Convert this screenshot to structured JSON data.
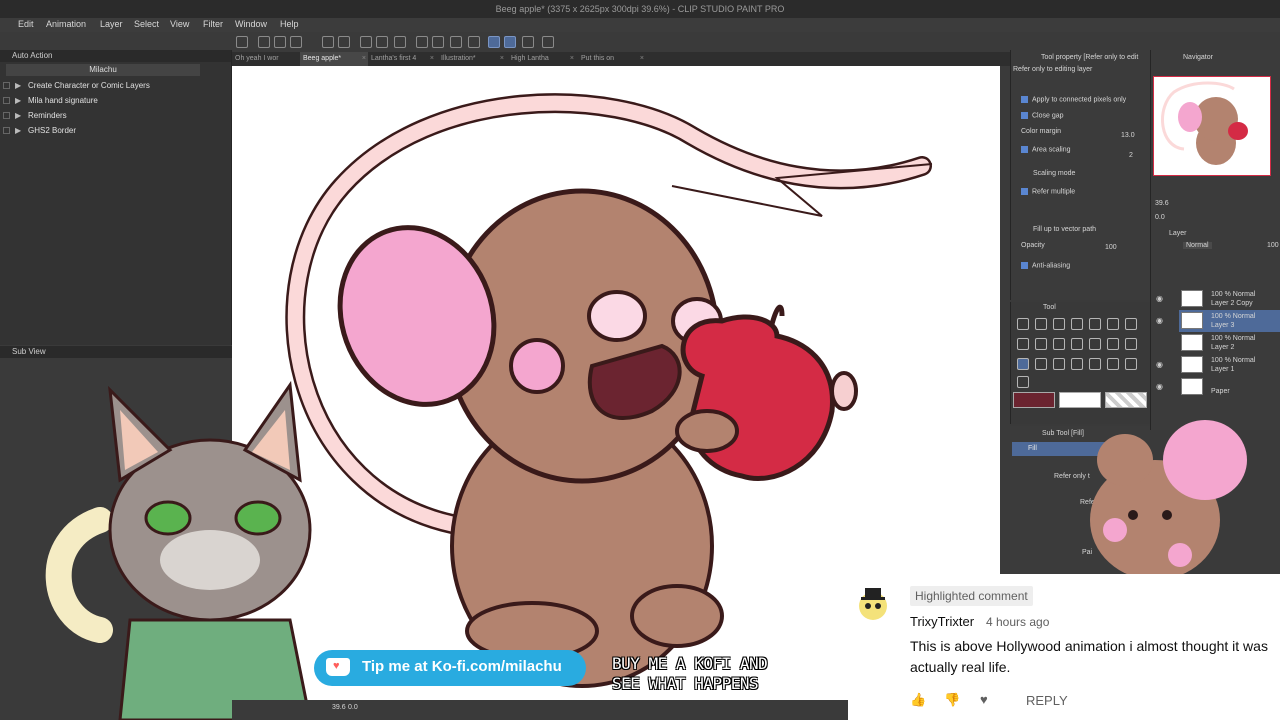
{
  "window": {
    "title": "Beeg apple* (3375 x 2625px 300dpi 39.6%)  - CLIP STUDIO PAINT PRO"
  },
  "menu": [
    "Edit",
    "Animation",
    "Layer",
    "Select",
    "View",
    "Filter",
    "Window",
    "Help"
  ],
  "left_panel": {
    "header": "Auto Action",
    "set_name": "Milachu",
    "actions": [
      "Create Character or Comic Layers",
      "Mila hand signature",
      "Reminders",
      "GHS2 Border"
    ],
    "subview_header": "Sub View"
  },
  "tabs": [
    {
      "label": "Oh yeah I wor"
    },
    {
      "label": "Beeg apple*",
      "active": true
    },
    {
      "label": "Lantha's first 4"
    },
    {
      "label": "Illustration*"
    },
    {
      "label": "High Lantha"
    },
    {
      "label": "Put this on"
    }
  ],
  "tool_property": {
    "header": "Tool property [Refer only to edit",
    "subheader": "Refer only to editing layer",
    "apply_connected": "Apply to connected pixels only",
    "close_gap": "Close gap",
    "color_margin_label": "Color margin",
    "color_margin_value": "13.0",
    "area_scaling": "Area scaling",
    "area_scaling_value": "2",
    "scaling_mode": "Scaling mode",
    "refer_multiple": "Refer multiple",
    "fill_vector": "Fill up to vector path",
    "opacity_label": "Opacity",
    "opacity_value": "100",
    "anti_aliasing": "Anti-aliasing"
  },
  "tool_palette": {
    "header": "Tool"
  },
  "subtool": {
    "header": "Sub Tool [Fill]",
    "items": [
      "Fill",
      "Refer only t",
      "Refer o",
      "Pai"
    ]
  },
  "navigator": {
    "header": "Navigator",
    "zoom": "39.6",
    "angle": "0.0"
  },
  "layer_panel": {
    "header": "Layer",
    "blend_mode": "Normal",
    "opacity": "100",
    "layers": [
      {
        "pct": "100 % Normal",
        "name": "Layer 2 Copy"
      },
      {
        "pct": "100 % Normal",
        "name": "Layer 3",
        "selected": true
      },
      {
        "pct": "100 % Normal",
        "name": "Layer 2"
      },
      {
        "pct": "100 % Normal",
        "name": "Layer 1"
      },
      {
        "pct": "",
        "name": "Paper"
      }
    ]
  },
  "comment": {
    "badge": "Highlighted comment",
    "author": "TrixyTrixter",
    "time": "4 hours ago",
    "text": "This is above Hollywood animation i almost thought it was actually real life.",
    "reply": "REPLY"
  },
  "kofi": {
    "label": "Tip me at Ko-fi.com/milachu"
  },
  "caption": {
    "line1": "BUY ME A KOFI AND",
    "line2": "SEE WHAT HAPPENS"
  },
  "colors": {
    "main_color": "#6b2430",
    "sub_color": "#ffffff",
    "kofi_blue": "#29abe0",
    "mouse_brown": "#b3836f",
    "ear_pink": "#f4a6cf",
    "apple_red": "#d42b45",
    "ui_accent": "#4e6a99"
  },
  "status_bar": {
    "zoom": "39.6",
    "angle": "0.0"
  }
}
